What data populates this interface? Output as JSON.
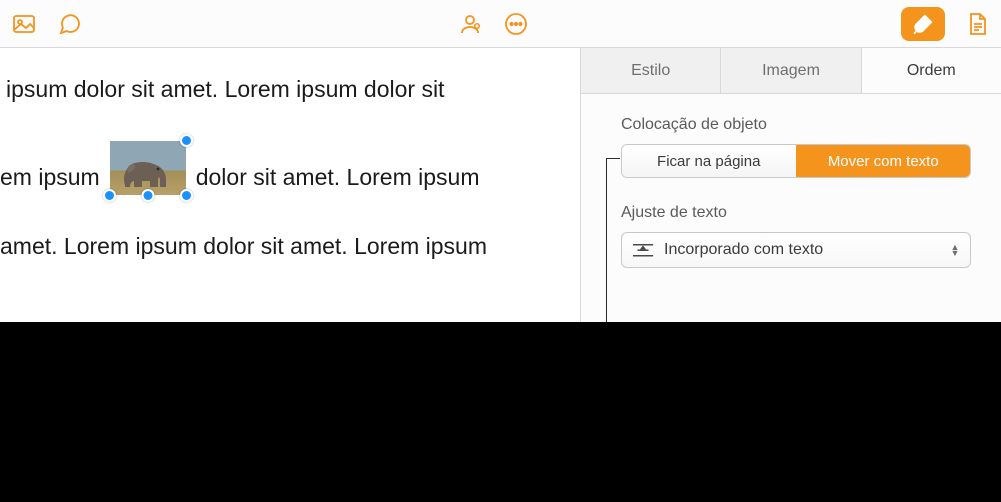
{
  "toolbar": {
    "icons": {
      "media": "media-icon",
      "comment": "comment-icon",
      "collaborate": "collaborate-icon",
      "more": "more-icon",
      "format": "format-brush-icon",
      "document": "document-icon"
    }
  },
  "document": {
    "line1": " ipsum dolor sit amet.  Lorem ipsum dolor sit",
    "line2_before": "em ipsum",
    "line2_after": "dolor sit amet. Lorem ipsum",
    "line3": "amet. Lorem ipsum dolor sit amet. Lorem ipsum"
  },
  "sidebar": {
    "tabs": {
      "style": "Estilo",
      "image": "Imagem",
      "order": "Ordem"
    },
    "placement": {
      "label": "Colocação de objeto",
      "stay": "Ficar na página",
      "move": "Mover com texto"
    },
    "wrap": {
      "label": "Ajuste de texto",
      "value": "Incorporado com texto"
    }
  }
}
